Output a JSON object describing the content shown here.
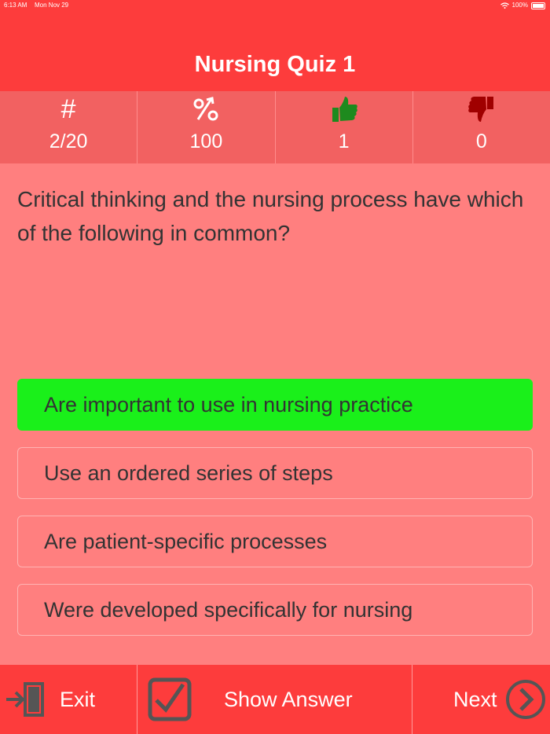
{
  "status_bar": {
    "time": "6:13 AM",
    "date": "Mon Nov 29",
    "battery": "100%"
  },
  "header": {
    "title": "Nursing Quiz 1"
  },
  "stats": [
    {
      "icon": "hash-icon",
      "value": "2/20"
    },
    {
      "icon": "percent-icon",
      "value": "100"
    },
    {
      "icon": "thumbs-up-icon",
      "value": "1"
    },
    {
      "icon": "thumbs-down-icon",
      "value": "0"
    }
  ],
  "question": "Critical thinking and the nursing process have which of the following in common?",
  "answers": [
    {
      "label": "Are important to use in nursing practice",
      "state": "correct"
    },
    {
      "label": "Use an ordered series of steps",
      "state": "default"
    },
    {
      "label": "Are patient-specific processes",
      "state": "default"
    },
    {
      "label": "Were developed specifically for nursing",
      "state": "default"
    }
  ],
  "bottom_bar": {
    "exit_label": "Exit",
    "show_answer_label": "Show Answer",
    "next_label": "Next"
  },
  "colors": {
    "header_red": "#fd3c3c",
    "stats_bg": "#f26161",
    "content_bg": "#ff7f7f",
    "correct_green": "#1af01a",
    "thumbs_up_green": "#1e8a1e",
    "thumbs_down_red": "#a00000"
  }
}
